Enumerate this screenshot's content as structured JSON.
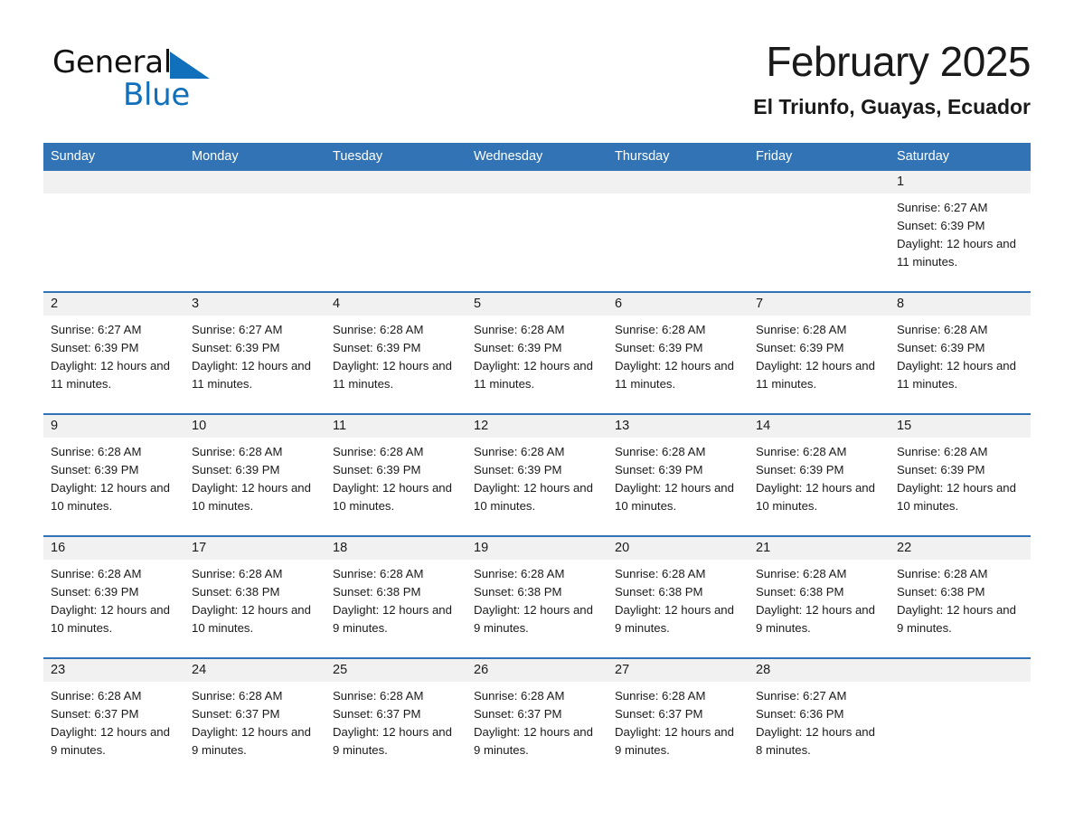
{
  "brand": {
    "name_dark": "General",
    "name_blue": "Blue",
    "triangle_color": "#1170bb"
  },
  "header": {
    "title": "February 2025",
    "subtitle": "El Triunfo, Guayas, Ecuador"
  },
  "theme": {
    "header_bar": "#3273b5",
    "daynum_strip": "#f1f1f1",
    "row_divider": "#3273b5",
    "text": "#1a1a1a",
    "page_background": "#ffffff"
  },
  "weekday_headers": [
    "Sunday",
    "Monday",
    "Tuesday",
    "Wednesday",
    "Thursday",
    "Friday",
    "Saturday"
  ],
  "weeks": [
    [
      {
        "day": "",
        "sunrise": "",
        "sunset": "",
        "daylight": "",
        "empty": true
      },
      {
        "day": "",
        "sunrise": "",
        "sunset": "",
        "daylight": "",
        "empty": true
      },
      {
        "day": "",
        "sunrise": "",
        "sunset": "",
        "daylight": "",
        "empty": true
      },
      {
        "day": "",
        "sunrise": "",
        "sunset": "",
        "daylight": "",
        "empty": true
      },
      {
        "day": "",
        "sunrise": "",
        "sunset": "",
        "daylight": "",
        "empty": true
      },
      {
        "day": "",
        "sunrise": "",
        "sunset": "",
        "daylight": "",
        "empty": true
      },
      {
        "day": "1",
        "sunrise": "Sunrise: 6:27 AM",
        "sunset": "Sunset: 6:39 PM",
        "daylight": "Daylight: 12 hours and 11 minutes.",
        "empty": false
      }
    ],
    [
      {
        "day": "2",
        "sunrise": "Sunrise: 6:27 AM",
        "sunset": "Sunset: 6:39 PM",
        "daylight": "Daylight: 12 hours and 11 minutes.",
        "empty": false
      },
      {
        "day": "3",
        "sunrise": "Sunrise: 6:27 AM",
        "sunset": "Sunset: 6:39 PM",
        "daylight": "Daylight: 12 hours and 11 minutes.",
        "empty": false
      },
      {
        "day": "4",
        "sunrise": "Sunrise: 6:28 AM",
        "sunset": "Sunset: 6:39 PM",
        "daylight": "Daylight: 12 hours and 11 minutes.",
        "empty": false
      },
      {
        "day": "5",
        "sunrise": "Sunrise: 6:28 AM",
        "sunset": "Sunset: 6:39 PM",
        "daylight": "Daylight: 12 hours and 11 minutes.",
        "empty": false
      },
      {
        "day": "6",
        "sunrise": "Sunrise: 6:28 AM",
        "sunset": "Sunset: 6:39 PM",
        "daylight": "Daylight: 12 hours and 11 minutes.",
        "empty": false
      },
      {
        "day": "7",
        "sunrise": "Sunrise: 6:28 AM",
        "sunset": "Sunset: 6:39 PM",
        "daylight": "Daylight: 12 hours and 11 minutes.",
        "empty": false
      },
      {
        "day": "8",
        "sunrise": "Sunrise: 6:28 AM",
        "sunset": "Sunset: 6:39 PM",
        "daylight": "Daylight: 12 hours and 11 minutes.",
        "empty": false
      }
    ],
    [
      {
        "day": "9",
        "sunrise": "Sunrise: 6:28 AM",
        "sunset": "Sunset: 6:39 PM",
        "daylight": "Daylight: 12 hours and 10 minutes.",
        "empty": false
      },
      {
        "day": "10",
        "sunrise": "Sunrise: 6:28 AM",
        "sunset": "Sunset: 6:39 PM",
        "daylight": "Daylight: 12 hours and 10 minutes.",
        "empty": false
      },
      {
        "day": "11",
        "sunrise": "Sunrise: 6:28 AM",
        "sunset": "Sunset: 6:39 PM",
        "daylight": "Daylight: 12 hours and 10 minutes.",
        "empty": false
      },
      {
        "day": "12",
        "sunrise": "Sunrise: 6:28 AM",
        "sunset": "Sunset: 6:39 PM",
        "daylight": "Daylight: 12 hours and 10 minutes.",
        "empty": false
      },
      {
        "day": "13",
        "sunrise": "Sunrise: 6:28 AM",
        "sunset": "Sunset: 6:39 PM",
        "daylight": "Daylight: 12 hours and 10 minutes.",
        "empty": false
      },
      {
        "day": "14",
        "sunrise": "Sunrise: 6:28 AM",
        "sunset": "Sunset: 6:39 PM",
        "daylight": "Daylight: 12 hours and 10 minutes.",
        "empty": false
      },
      {
        "day": "15",
        "sunrise": "Sunrise: 6:28 AM",
        "sunset": "Sunset: 6:39 PM",
        "daylight": "Daylight: 12 hours and 10 minutes.",
        "empty": false
      }
    ],
    [
      {
        "day": "16",
        "sunrise": "Sunrise: 6:28 AM",
        "sunset": "Sunset: 6:39 PM",
        "daylight": "Daylight: 12 hours and 10 minutes.",
        "empty": false
      },
      {
        "day": "17",
        "sunrise": "Sunrise: 6:28 AM",
        "sunset": "Sunset: 6:38 PM",
        "daylight": "Daylight: 12 hours and 10 minutes.",
        "empty": false
      },
      {
        "day": "18",
        "sunrise": "Sunrise: 6:28 AM",
        "sunset": "Sunset: 6:38 PM",
        "daylight": "Daylight: 12 hours and 9 minutes.",
        "empty": false
      },
      {
        "day": "19",
        "sunrise": "Sunrise: 6:28 AM",
        "sunset": "Sunset: 6:38 PM",
        "daylight": "Daylight: 12 hours and 9 minutes.",
        "empty": false
      },
      {
        "day": "20",
        "sunrise": "Sunrise: 6:28 AM",
        "sunset": "Sunset: 6:38 PM",
        "daylight": "Daylight: 12 hours and 9 minutes.",
        "empty": false
      },
      {
        "day": "21",
        "sunrise": "Sunrise: 6:28 AM",
        "sunset": "Sunset: 6:38 PM",
        "daylight": "Daylight: 12 hours and 9 minutes.",
        "empty": false
      },
      {
        "day": "22",
        "sunrise": "Sunrise: 6:28 AM",
        "sunset": "Sunset: 6:38 PM",
        "daylight": "Daylight: 12 hours and 9 minutes.",
        "empty": false
      }
    ],
    [
      {
        "day": "23",
        "sunrise": "Sunrise: 6:28 AM",
        "sunset": "Sunset: 6:37 PM",
        "daylight": "Daylight: 12 hours and 9 minutes.",
        "empty": false
      },
      {
        "day": "24",
        "sunrise": "Sunrise: 6:28 AM",
        "sunset": "Sunset: 6:37 PM",
        "daylight": "Daylight: 12 hours and 9 minutes.",
        "empty": false
      },
      {
        "day": "25",
        "sunrise": "Sunrise: 6:28 AM",
        "sunset": "Sunset: 6:37 PM",
        "daylight": "Daylight: 12 hours and 9 minutes.",
        "empty": false
      },
      {
        "day": "26",
        "sunrise": "Sunrise: 6:28 AM",
        "sunset": "Sunset: 6:37 PM",
        "daylight": "Daylight: 12 hours and 9 minutes.",
        "empty": false
      },
      {
        "day": "27",
        "sunrise": "Sunrise: 6:28 AM",
        "sunset": "Sunset: 6:37 PM",
        "daylight": "Daylight: 12 hours and 9 minutes.",
        "empty": false
      },
      {
        "day": "28",
        "sunrise": "Sunrise: 6:27 AM",
        "sunset": "Sunset: 6:36 PM",
        "daylight": "Daylight: 12 hours and 8 minutes.",
        "empty": false
      },
      {
        "day": "",
        "sunrise": "",
        "sunset": "",
        "daylight": "",
        "empty": true
      }
    ]
  ]
}
